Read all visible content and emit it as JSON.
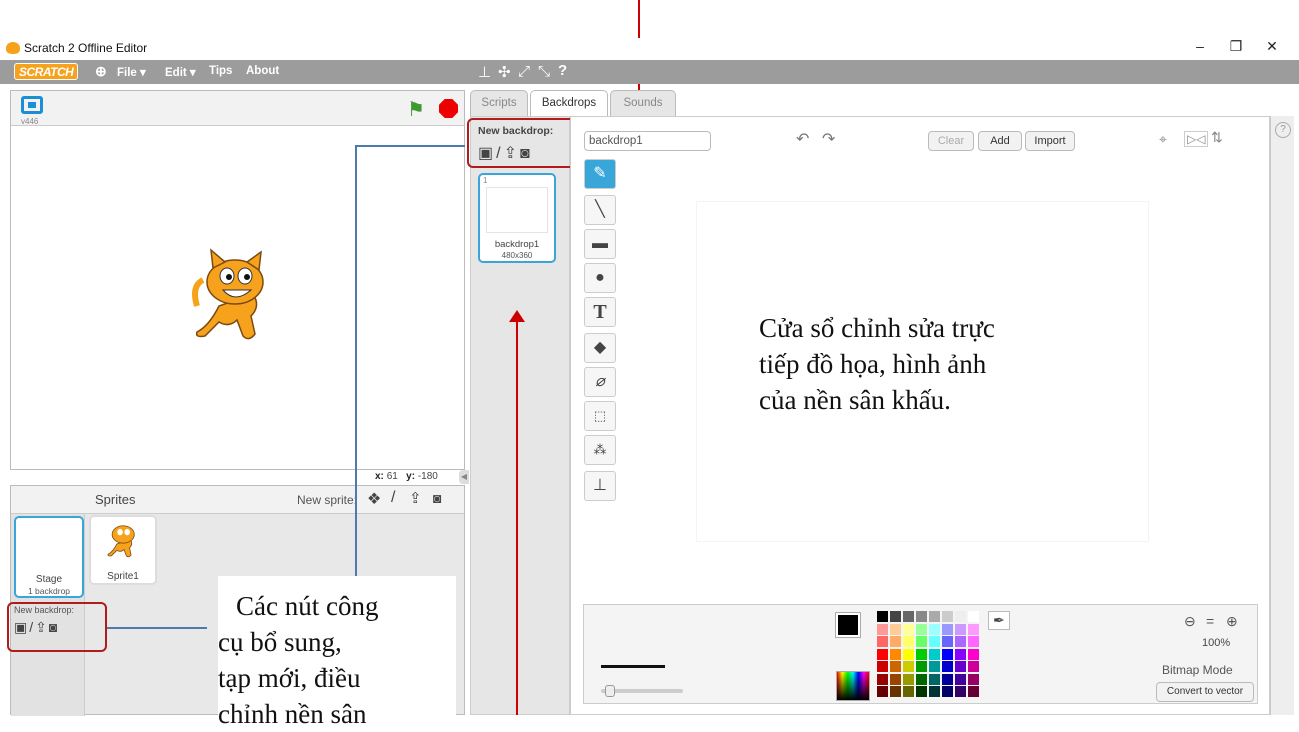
{
  "window": {
    "title": "Scratch 2 Offline Editor",
    "min": "–",
    "restore": "❐",
    "close": "✕"
  },
  "menubar": {
    "logo": "SCRATCH",
    "file": "File ▾",
    "edit": "Edit ▾",
    "tips": "Tips",
    "about": "About"
  },
  "stage": {
    "version": "v446",
    "x_label": "x:",
    "x_value": "61",
    "y_label": "y:",
    "y_value": "-180"
  },
  "sprites": {
    "header": "Sprites",
    "new_sprite": "New sprite:",
    "stage_label": "Stage",
    "stage_sub": "1 backdrop",
    "sprite1": "Sprite1",
    "new_backdrop": "New backdrop:"
  },
  "tabs": {
    "scripts": "Scripts",
    "backdrops": "Backdrops",
    "sounds": "Sounds"
  },
  "backdrops": {
    "new_backdrop": "New backdrop:",
    "item_index": "1",
    "item_name": "backdrop1",
    "item_size": "480x360"
  },
  "editor": {
    "name_value": "backdrop1",
    "clear": "Clear",
    "add": "Add",
    "import": "Import",
    "zoom": "100%",
    "mode": "Bitmap Mode",
    "convert": "Convert to vector"
  },
  "annotations": {
    "canvas_note": [
      "Cửa sổ chỉnh sửa trực",
      "tiếp đồ họa, hình ảnh",
      "của nền sân khấu."
    ],
    "left_note": [
      "Các nút công",
      "cụ bổ sung,",
      "tạp mới, điều",
      "chỉnh nền sân"
    ]
  },
  "colors": {
    "accent": "#38a6d9",
    "menubar": "#9c9c9c",
    "annotation_red": "#b01c1c",
    "annotation_line": "#4d7bab"
  }
}
